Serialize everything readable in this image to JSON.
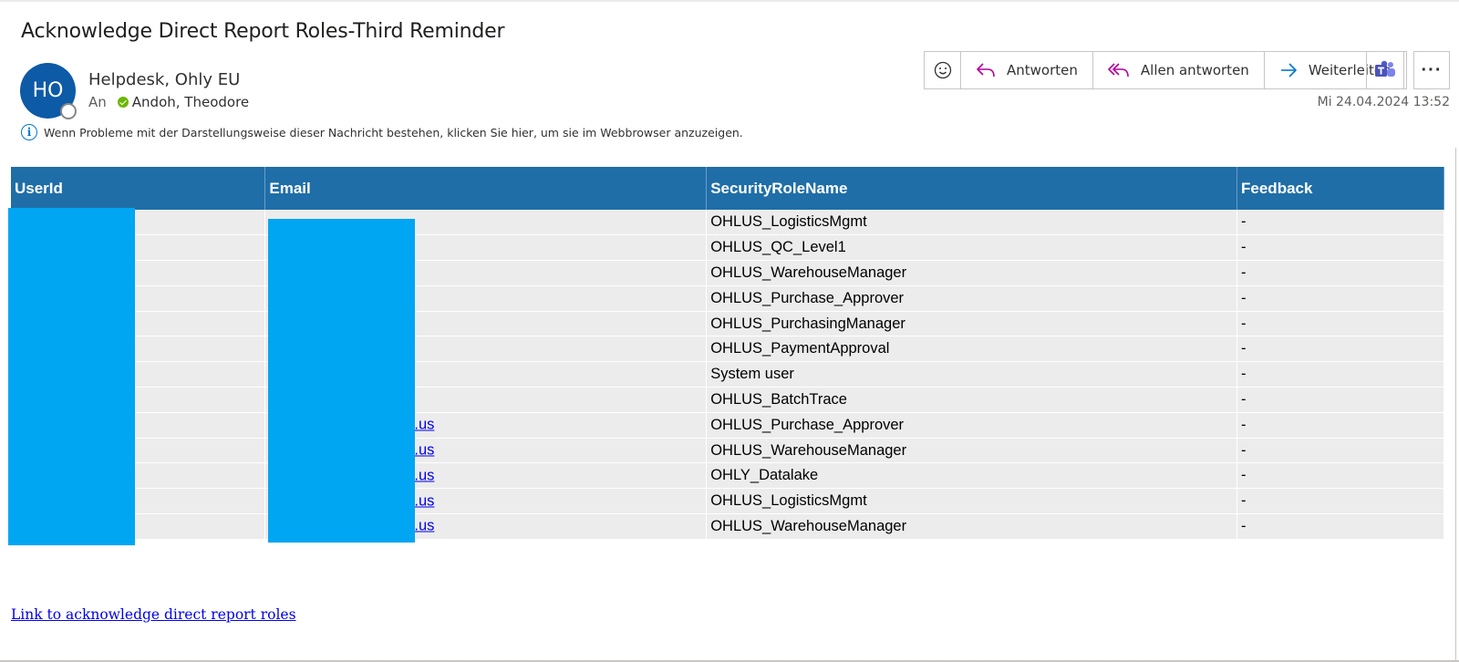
{
  "header": {
    "subject": "Acknowledge Direct Report Roles-Third Reminder",
    "avatar_initials": "HO",
    "sender": "Helpdesk, Ohly EU",
    "to_label": "An",
    "recipient": "Andoh, Theodore",
    "date": "Mi 24.04.2024 13:52",
    "info_text": "Wenn Probleme mit der Darstellungsweise dieser Nachricht bestehen, klicken Sie hier, um sie im Webbrowser anzuzeigen."
  },
  "actions": {
    "reply": "Antworten",
    "reply_all": "Allen antworten",
    "forward": "Weiterleiten",
    "more": "···"
  },
  "colors": {
    "table_header": "#1f6ea8",
    "redaction": "#00a6f2",
    "avatar": "#0d5aa7"
  },
  "table": {
    "headers": [
      "UserId",
      "Email",
      "SecurityRoleName",
      "Feedback"
    ],
    "rows": [
      {
        "email_suffix": "",
        "role": "OHLUS_LogisticsMgmt",
        "feedback": "-"
      },
      {
        "email_suffix": "",
        "role": "OHLUS_QC_Level1",
        "feedback": "-"
      },
      {
        "email_suffix": "",
        "role": "OHLUS_WarehouseManager",
        "feedback": "-"
      },
      {
        "email_suffix": "",
        "role": "OHLUS_Purchase_Approver",
        "feedback": "-"
      },
      {
        "email_suffix": "",
        "role": "OHLUS_PurchasingManager",
        "feedback": "-"
      },
      {
        "email_suffix": "",
        "role": "OHLUS_PaymentApproval",
        "feedback": "-"
      },
      {
        "email_suffix": "",
        "role": "System user",
        "feedback": "-"
      },
      {
        "email_suffix": "",
        "role": "OHLUS_BatchTrace",
        "feedback": "-"
      },
      {
        "email_suffix": ".us",
        "role": "OHLUS_Purchase_Approver",
        "feedback": "-"
      },
      {
        "email_suffix": ".us",
        "role": "OHLUS_WarehouseManager",
        "feedback": "-"
      },
      {
        "email_suffix": ".us",
        "role": "OHLY_Datalake",
        "feedback": "-"
      },
      {
        "email_suffix": ".us",
        "role": "OHLUS_LogisticsMgmt",
        "feedback": "-"
      },
      {
        "email_suffix": ".us",
        "role": "OHLUS_WarehouseManager",
        "feedback": "-"
      }
    ]
  },
  "footer": {
    "link_text": "Link to acknowledge direct report roles"
  }
}
